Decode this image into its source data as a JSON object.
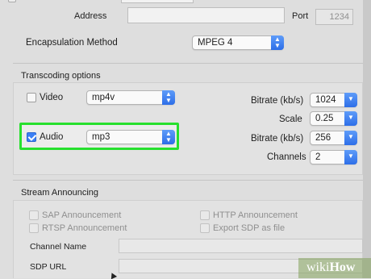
{
  "top": {
    "address_label": "Address",
    "port_label": "Port",
    "port_value": "1234",
    "encapsulation_label": "Encapsulation Method",
    "encapsulation_value": "MPEG 4"
  },
  "transcoding": {
    "title": "Transcoding options",
    "video_label": "Video",
    "video_codec": "mp4v",
    "video_checked": false,
    "audio_label": "Audio",
    "audio_codec": "mp3",
    "audio_checked": true,
    "video_bitrate_label": "Bitrate (kb/s)",
    "video_bitrate_value": "1024",
    "scale_label": "Scale",
    "scale_value": "0.25",
    "audio_bitrate_label": "Bitrate (kb/s)",
    "audio_bitrate_value": "256",
    "channels_label": "Channels",
    "channels_value": "2"
  },
  "stream": {
    "title": "Stream Announcing",
    "sap_label": "SAP Announcement",
    "rtsp_label": "RTSP Announcement",
    "http_label": "HTTP Announcement",
    "export_sdp_label": "Export SDP as file",
    "channel_name_label": "Channel Name",
    "sdp_url_label": "SDP URL"
  },
  "watermark": {
    "brand": "wiki",
    "brand_bold": "How"
  },
  "colors": {
    "accent": "#3b7ff5",
    "highlight": "#27e02e"
  }
}
